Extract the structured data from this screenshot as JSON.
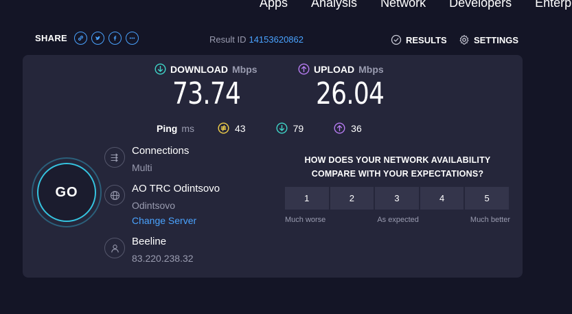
{
  "nav": {
    "items": [
      "Apps",
      "Analysis",
      "Network",
      "Developers",
      "Enterprise"
    ]
  },
  "share": {
    "label": "SHARE"
  },
  "result": {
    "label": "Result ID",
    "id": "14153620862"
  },
  "links": {
    "results": "RESULTS",
    "settings": "SETTINGS"
  },
  "download": {
    "label": "DOWNLOAD",
    "unit": "Mbps",
    "value": "73.74"
  },
  "upload": {
    "label": "UPLOAD",
    "unit": "Mbps",
    "value": "26.04"
  },
  "ping": {
    "label": "Ping",
    "unit": "ms",
    "idle": "43",
    "download": "79",
    "upload": "36"
  },
  "go": {
    "label": "GO"
  },
  "connections": {
    "title": "Connections",
    "value": "Multi"
  },
  "server": {
    "name": "AO TRC Odintsovo",
    "location": "Odintsovo",
    "change": "Change Server"
  },
  "isp": {
    "name": "Beeline",
    "ip": "83.220.238.32"
  },
  "survey": {
    "question_line1": "HOW DOES YOUR NETWORK AVAILABILITY",
    "question_line2": "COMPARE WITH YOUR EXPECTATIONS?",
    "options": [
      "1",
      "2",
      "3",
      "4",
      "5"
    ],
    "low": "Much worse",
    "mid": "As expected",
    "high": "Much better"
  },
  "colors": {
    "background": "#141526",
    "card": "#25263a",
    "accent_blue": "#4aa3ff",
    "download": "#3fd6c9",
    "upload": "#b77cf2",
    "ping_idle": "#f2d04a"
  }
}
